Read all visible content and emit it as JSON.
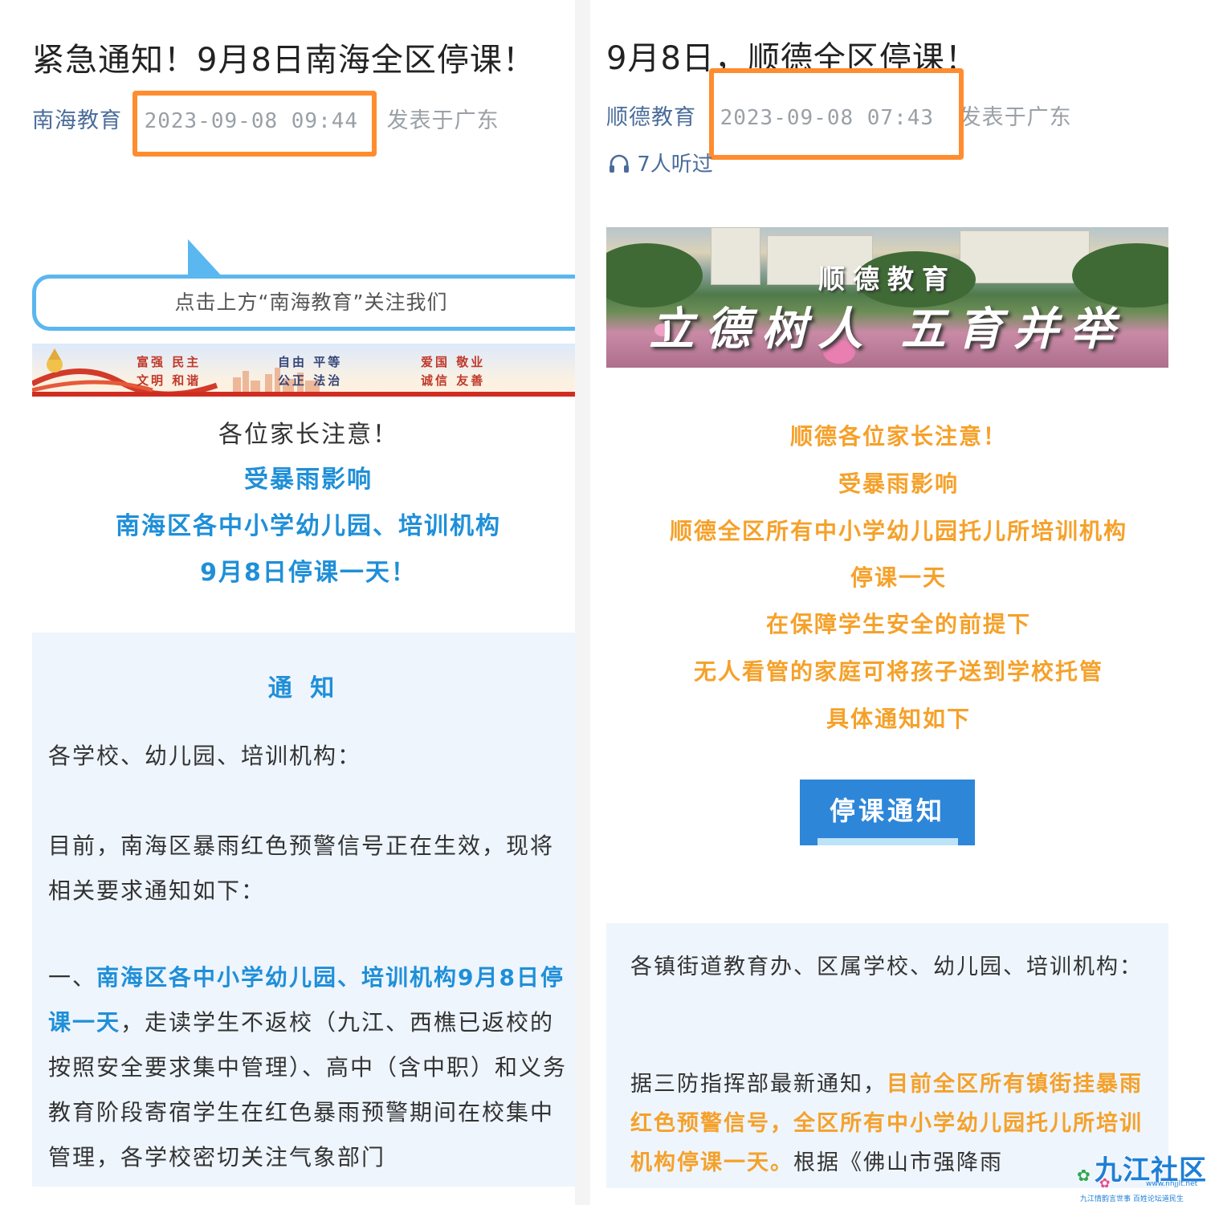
{
  "left": {
    "title": "紧急通知！9月8日南海全区停课！",
    "account": "南海教育",
    "timestamp": "2023-09-08 09:44",
    "location": "发表于广东",
    "follow_prompt": "点击上方“南海教育”关注我们",
    "values": [
      "富强 民主",
      "文明 和谐",
      "自由 平等",
      "公正 法治",
      "爱国 敬业",
      "诚信 友善"
    ],
    "headline": [
      "各位家长注意！",
      "受暴雨影响",
      "南海区各中小学幼儿园、培训机构",
      "9月8日停课一天！"
    ],
    "notice": {
      "heading": "通 知",
      "salutation": "各学校、幼儿园、培训机构：",
      "intro": "目前，南海区暴雨红色预警信号正在生效，现将相关要求通知如下：",
      "item1_prefix": "一、",
      "item1_highlight": "南海区各中小学幼儿园、培训机构9月8日停课一天",
      "item1_rest": "，走读学生不返校（九江、西樵已返校的按照安全要求集中管理）、高中（含中职）和义务教育阶段寄宿学生在红色暴雨预警期间在校集中管理，各学校密切关注气象部门"
    }
  },
  "right": {
    "title": "9月8日，顺德全区停课！",
    "account": "顺德教育",
    "timestamp": "2023-09-08 07:43",
    "location": "发表于广东",
    "listen_count": "7人听过",
    "banner_title": "顺德教育",
    "banner_slogan": "立德树人 五育并举",
    "headline": [
      "顺德各位家长注意！",
      "受暴雨影响",
      "顺德全区所有中小学幼儿园托儿所培训机构",
      "停课一天",
      "在保障学生安全的前提下",
      "无人看管的家庭可将孩子送到学校托管",
      "具体通知如下"
    ],
    "button_label": "停课通知",
    "notice": {
      "salutation": "各镇街道教育办、区属学校、幼儿园、培训机构：",
      "p1_prefix": "据三防指挥部最新通知，",
      "p1_highlight": "目前全区所有镇街挂暴雨红色预警信号，全区所有中小学幼儿园托儿所培训机构停课一天。",
      "p1_rest": "根据《佛山市强降雨"
    }
  },
  "watermark": {
    "main": "九江社区",
    "url": "www.nhjjlt.net",
    "sub": "九江情韵言世事  百姓论坛道民生"
  },
  "colors": {
    "highlight_border": "#ff8c2e",
    "nanhai_blue": "#1f8fd8",
    "shunde_orange": "#f5a12a",
    "button_blue": "#2e86d9"
  }
}
